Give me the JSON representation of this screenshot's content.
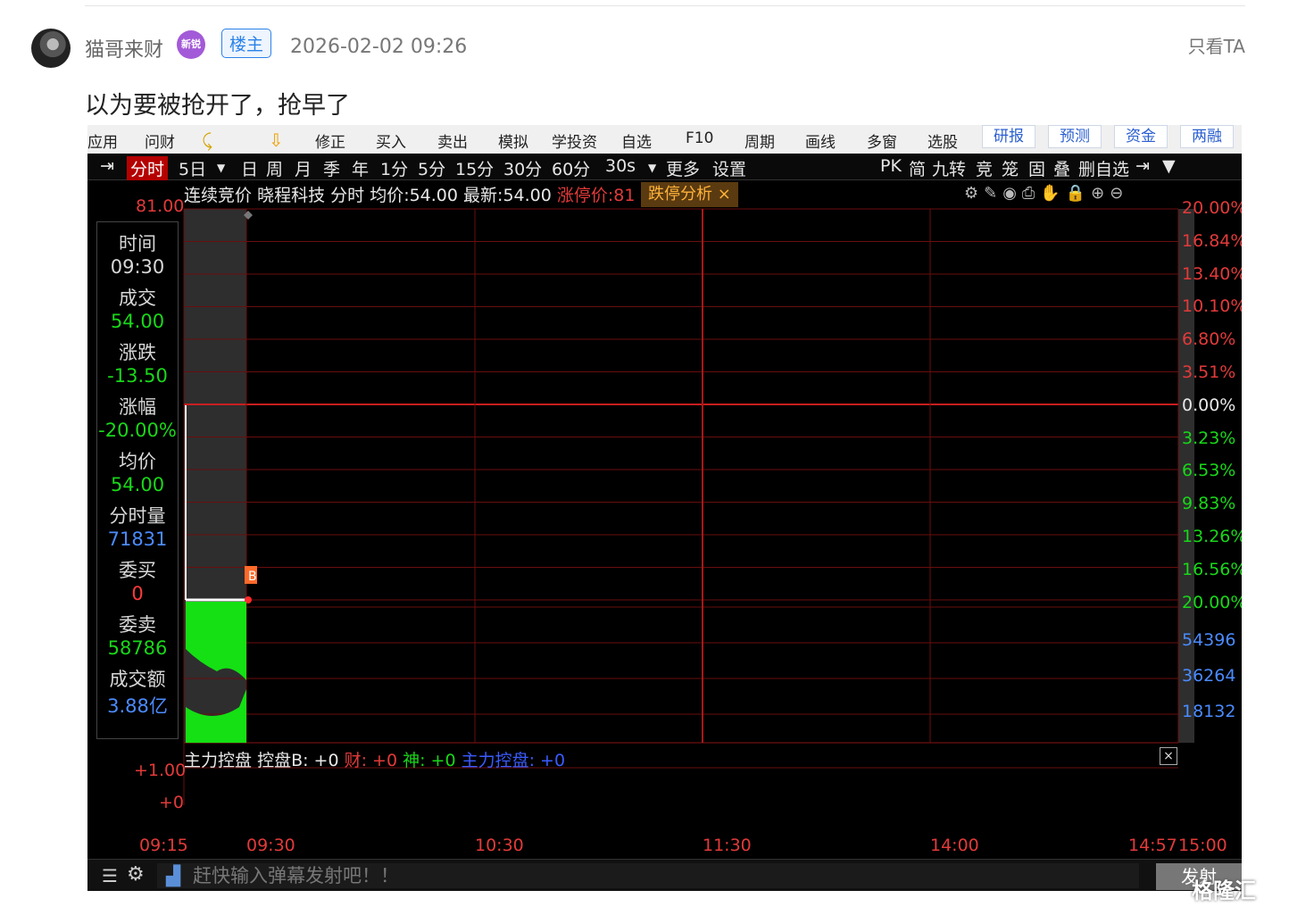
{
  "post": {
    "username": "猫哥来财",
    "badge": "新锐",
    "owner_tag": "楼主",
    "time": "2026-02-02 09:26",
    "only_ta": "只看TA",
    "text": "以为要被抢开了，抢早了"
  },
  "app": {
    "menu": [
      "应用",
      "问财",
      "修正",
      "买入",
      "卖出",
      "模拟",
      "学投资",
      "自选",
      "F10",
      "周期",
      "画线",
      "多窗",
      "选股"
    ],
    "menu_right": [
      "研报",
      "预测",
      "资金",
      "两融"
    ],
    "periods": [
      "分时",
      "5日",
      "日",
      "周",
      "月",
      "季",
      "年",
      "1分",
      "5分",
      "15分",
      "30分",
      "60分",
      "30s",
      "更多",
      "设置"
    ],
    "active_period": "分时",
    "right_tools": [
      "PK",
      "简",
      "九转",
      "竞",
      "笼",
      "固",
      "叠",
      "删自选"
    ],
    "header": {
      "prefix": "连续竞价",
      "stock": "晓程科技",
      "mode": "分时",
      "avg_label": "均价:",
      "avg": "54.00",
      "last_label": "最新:",
      "last": "54.00",
      "limit_up": "涨停价:81",
      "tag": "跌停分析",
      "tag_close": "×"
    },
    "tools_icons": [
      "gear-icon",
      "pen-icon",
      "eye-icon",
      "print-icon",
      "hand-icon",
      "lock-icon",
      "zoom-in-icon",
      "zoom-out-icon"
    ],
    "tool_glyphs": "⚙✎◉⎙✋🔒⊕⊖",
    "side": [
      {
        "label": "时间",
        "value": "09:30",
        "kind": "w"
      },
      {
        "label": "成交",
        "value": "54.00",
        "kind": "g"
      },
      {
        "label": "涨跌",
        "value": "-13.50",
        "kind": "g"
      },
      {
        "label": "涨幅",
        "value": "-20.00%",
        "kind": "g"
      },
      {
        "label": "均价",
        "value": "54.00",
        "kind": "g"
      },
      {
        "label": "分时量",
        "value": "71831",
        "kind": "b"
      },
      {
        "label": "委买",
        "value": "0",
        "kind": "r"
      },
      {
        "label": "委卖",
        "value": "58786",
        "kind": "g"
      },
      {
        "label": "成交额",
        "value": "3.88亿",
        "kind": "b"
      }
    ],
    "price_top": "81.00",
    "right_pct": [
      {
        "t": "20.00%",
        "c": "#e23a3a"
      },
      {
        "t": "16.84%",
        "c": "#e23a3a"
      },
      {
        "t": "13.40%",
        "c": "#e23a3a"
      },
      {
        "t": "10.10%",
        "c": "#e23a3a"
      },
      {
        "t": "6.80%",
        "c": "#e23a3a"
      },
      {
        "t": "3.51%",
        "c": "#e23a3a"
      },
      {
        "t": "0.00%",
        "c": "#e8e8e8"
      },
      {
        "t": "3.23%",
        "c": "#19d719"
      },
      {
        "t": "6.53%",
        "c": "#19d719"
      },
      {
        "t": "9.83%",
        "c": "#19d719"
      },
      {
        "t": "13.26%",
        "c": "#19d719"
      },
      {
        "t": "16.56%",
        "c": "#19d719"
      },
      {
        "t": "20.00%",
        "c": "#19d719"
      }
    ],
    "volume_labels": [
      "54396",
      "36264",
      "18132"
    ],
    "indicator": {
      "name": "主力控盘",
      "b": "控盘B: +0",
      "cai": "财: +0",
      "shen": "神: +0",
      "zl": "主力控盘: +0",
      "close": "×"
    },
    "indicator_axis": [
      "+1.00",
      "+0"
    ],
    "time_axis": [
      "09:15",
      "09:30",
      "10:30",
      "11:30",
      "14:00",
      "14:57",
      "15:00"
    ],
    "marker": "B",
    "danmu_placeholder": "赶快输入弹幕发射吧！！",
    "send": "发射",
    "watermark": "格隆汇"
  },
  "chart_data": {
    "type": "line",
    "title": "",
    "series": [
      {
        "values": [
          54.0
        ]
      }
    ],
    "ylim": [
      54.0,
      81.0
    ]
  }
}
